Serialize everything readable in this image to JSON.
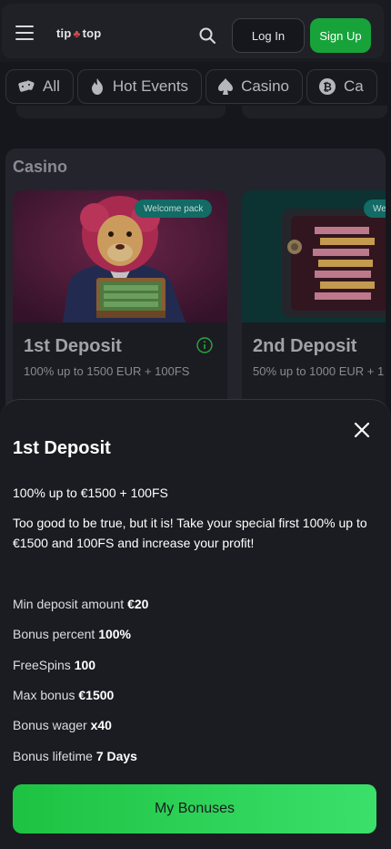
{
  "header": {
    "logo_left": "tip",
    "logo_right": "top",
    "login_label": "Log In",
    "signup_label": "Sign Up"
  },
  "tabs": [
    {
      "label": "All",
      "icon": "dice-icon"
    },
    {
      "label": "Hot Events",
      "icon": "flame-icon"
    },
    {
      "label": "Casino",
      "icon": "spade-icon"
    },
    {
      "label": "Ca",
      "icon": "bitcoin-icon"
    }
  ],
  "casino": {
    "title": "Casino",
    "cards": [
      {
        "badge": "Welcome pack",
        "title": "1st Deposit",
        "subtitle": "100% up to 1500 EUR + 100FS"
      },
      {
        "badge": "We",
        "title": "2nd Deposit",
        "subtitle": "50% up to 1000 EUR + 1"
      }
    ]
  },
  "sheet": {
    "title": "1st Deposit",
    "headline": "100% up to €1500 + 100FS",
    "description": "Too good to be true, but it is! Take your special first 100% up to €1500 and 100FS and increase your profit!",
    "details": [
      {
        "label": "Min deposit amount",
        "value": "€20"
      },
      {
        "label": "Bonus percent",
        "value": "100%"
      },
      {
        "label": "FreeSpins",
        "value": "100"
      },
      {
        "label": "Max bonus",
        "value": "€1500"
      },
      {
        "label": "Bonus wager",
        "value": "x40"
      },
      {
        "label": "Bonus lifetime",
        "value": "7 Days"
      }
    ],
    "button_label": "My Bonuses"
  },
  "colors": {
    "accent_green": "#18a33a",
    "badge_teal": "#157a73",
    "background": "#1a1b21"
  }
}
